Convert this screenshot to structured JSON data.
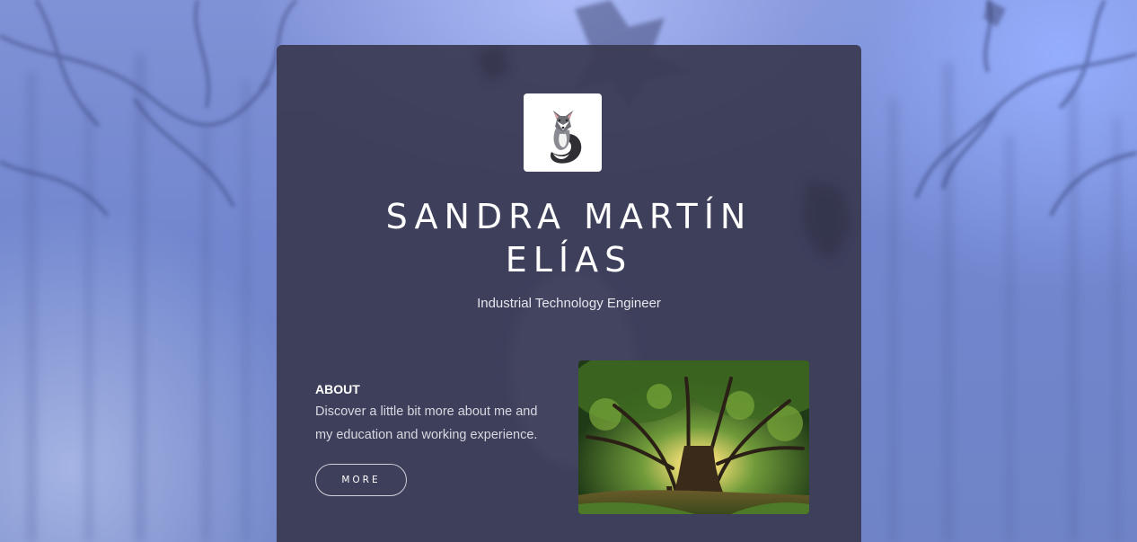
{
  "profile": {
    "name_line1": "SANDRA MARTÍN",
    "name_line2": "ELÍAS",
    "title": "Industrial Technology Engineer"
  },
  "about": {
    "heading": "ABOUT",
    "text_line1": "Discover a little bit more about me and",
    "text_line2": "my education and working experience.",
    "button_label": "MORE"
  },
  "images": {
    "logo": "fox-logo-icon",
    "photo": "tree-photo"
  },
  "colors": {
    "card_background": "#3a3a52",
    "background_accent": "#7286cf",
    "text": "#ffffff"
  }
}
